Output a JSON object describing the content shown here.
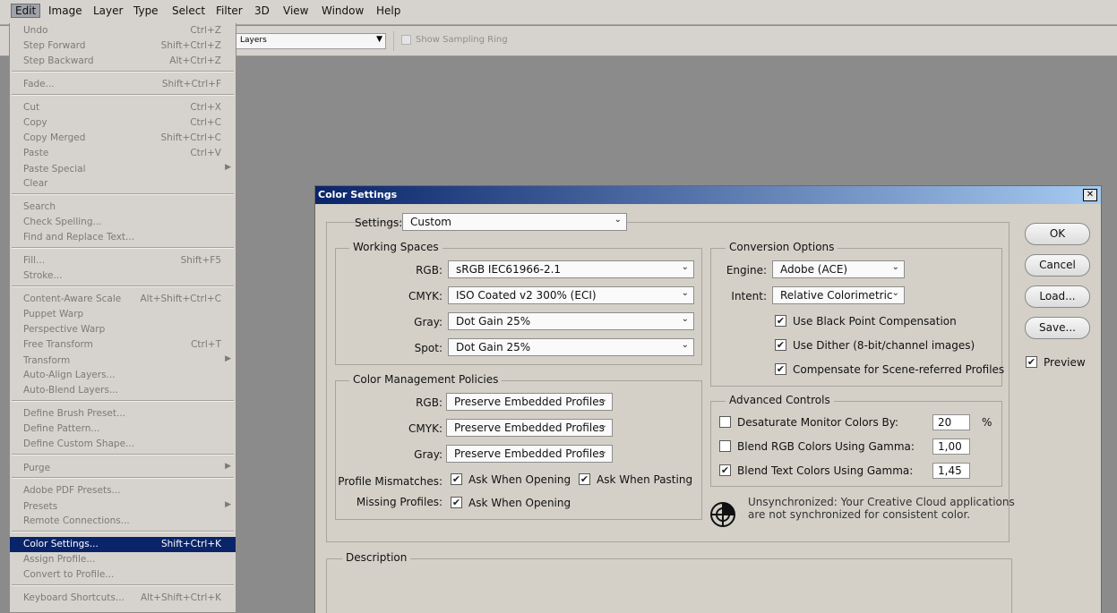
{
  "menubar": {
    "items": [
      "Edit",
      "Image",
      "Layer",
      "Type",
      "Select",
      "Filter",
      "3D",
      "View",
      "Window",
      "Help"
    ],
    "active": "Edit"
  },
  "options_bar": {
    "sample_select": "Layers",
    "sampling_ring_label": "Show Sampling Ring"
  },
  "edit_menu": {
    "undo": {
      "label": "Undo",
      "shortcut": "Ctrl+Z"
    },
    "step_forward": {
      "label": "Step Forward",
      "shortcut": "Shift+Ctrl+Z"
    },
    "step_backward": {
      "label": "Step Backward",
      "shortcut": "Alt+Ctrl+Z"
    },
    "fade": {
      "label": "Fade...",
      "shortcut": "Shift+Ctrl+F"
    },
    "cut": {
      "label": "Cut",
      "shortcut": "Ctrl+X"
    },
    "copy": {
      "label": "Copy",
      "shortcut": "Ctrl+C"
    },
    "copy_merged": {
      "label": "Copy Merged",
      "shortcut": "Shift+Ctrl+C"
    },
    "paste": {
      "label": "Paste",
      "shortcut": "Ctrl+V"
    },
    "paste_special": {
      "label": "Paste Special"
    },
    "clear": {
      "label": "Clear"
    },
    "search": {
      "label": "Search"
    },
    "check_spelling": {
      "label": "Check Spelling..."
    },
    "find_replace": {
      "label": "Find and Replace Text..."
    },
    "fill": {
      "label": "Fill...",
      "shortcut": "Shift+F5"
    },
    "stroke": {
      "label": "Stroke..."
    },
    "content_aware": {
      "label": "Content-Aware Scale",
      "shortcut": "Alt+Shift+Ctrl+C"
    },
    "puppet_warp": {
      "label": "Puppet Warp"
    },
    "perspective_warp": {
      "label": "Perspective Warp"
    },
    "free_transform": {
      "label": "Free Transform",
      "shortcut": "Ctrl+T"
    },
    "transform": {
      "label": "Transform"
    },
    "auto_align": {
      "label": "Auto-Align Layers..."
    },
    "auto_blend": {
      "label": "Auto-Blend Layers..."
    },
    "define_brush": {
      "label": "Define Brush Preset..."
    },
    "define_pattern": {
      "label": "Define Pattern..."
    },
    "define_shape": {
      "label": "Define Custom Shape..."
    },
    "purge": {
      "label": "Purge"
    },
    "pdf_presets": {
      "label": "Adobe PDF Presets..."
    },
    "presets": {
      "label": "Presets"
    },
    "remote": {
      "label": "Remote Connections..."
    },
    "color_settings": {
      "label": "Color Settings...",
      "shortcut": "Shift+Ctrl+K"
    },
    "assign_profile": {
      "label": "Assign Profile..."
    },
    "convert_profile": {
      "label": "Convert to Profile..."
    },
    "keyboard": {
      "label": "Keyboard Shortcuts...",
      "shortcut": "Alt+Shift+Ctrl+K"
    }
  },
  "dialog": {
    "title": "Color Settings",
    "close": "✕",
    "settings_label": "Settings:",
    "settings_value": "Custom",
    "working_spaces": {
      "title": "Working Spaces",
      "rgb_label": "RGB:",
      "rgb_value": "sRGB IEC61966-2.1",
      "cmyk_label": "CMYK:",
      "cmyk_value": "ISO Coated v2 300% (ECI)",
      "gray_label": "Gray:",
      "gray_value": "Dot Gain 25%",
      "spot_label": "Spot:",
      "spot_value": "Dot Gain 25%"
    },
    "policies": {
      "title": "Color Management Policies",
      "rgb_label": "RGB:",
      "rgb_value": "Preserve Embedded Profiles",
      "cmyk_label": "CMYK:",
      "cmyk_value": "Preserve Embedded Profiles",
      "gray_label": "Gray:",
      "gray_value": "Preserve Embedded Profiles",
      "mismatch_label": "Profile Mismatches:",
      "ask_opening": "Ask When Opening",
      "ask_pasting": "Ask When Pasting",
      "missing_label": "Missing Profiles:",
      "missing_ask_opening": "Ask When Opening"
    },
    "conversion": {
      "title": "Conversion Options",
      "engine_label": "Engine:",
      "engine_value": "Adobe (ACE)",
      "intent_label": "Intent:",
      "intent_value": "Relative Colorimetric",
      "black_point": "Use Black Point Compensation",
      "dither": "Use Dither (8-bit/channel images)",
      "scene_referred": "Compensate for Scene-referred Profiles"
    },
    "advanced": {
      "title": "Advanced Controls",
      "desaturate_label": "Desaturate Monitor Colors By:",
      "desaturate_value": "20",
      "percent": "%",
      "blend_rgb_label": "Blend RGB Colors Using Gamma:",
      "blend_rgb_value": "1,00",
      "blend_text_label": "Blend Text Colors Using Gamma:",
      "blend_text_value": "1,45"
    },
    "sync_line1": "Unsynchronized: Your Creative Cloud applications",
    "sync_line2": "are not synchronized for consistent color.",
    "description_title": "Description",
    "buttons": {
      "ok": "OK",
      "cancel": "Cancel",
      "load": "Load...",
      "save": "Save..."
    },
    "preview_label": "Preview"
  },
  "check_glyph": "✔"
}
